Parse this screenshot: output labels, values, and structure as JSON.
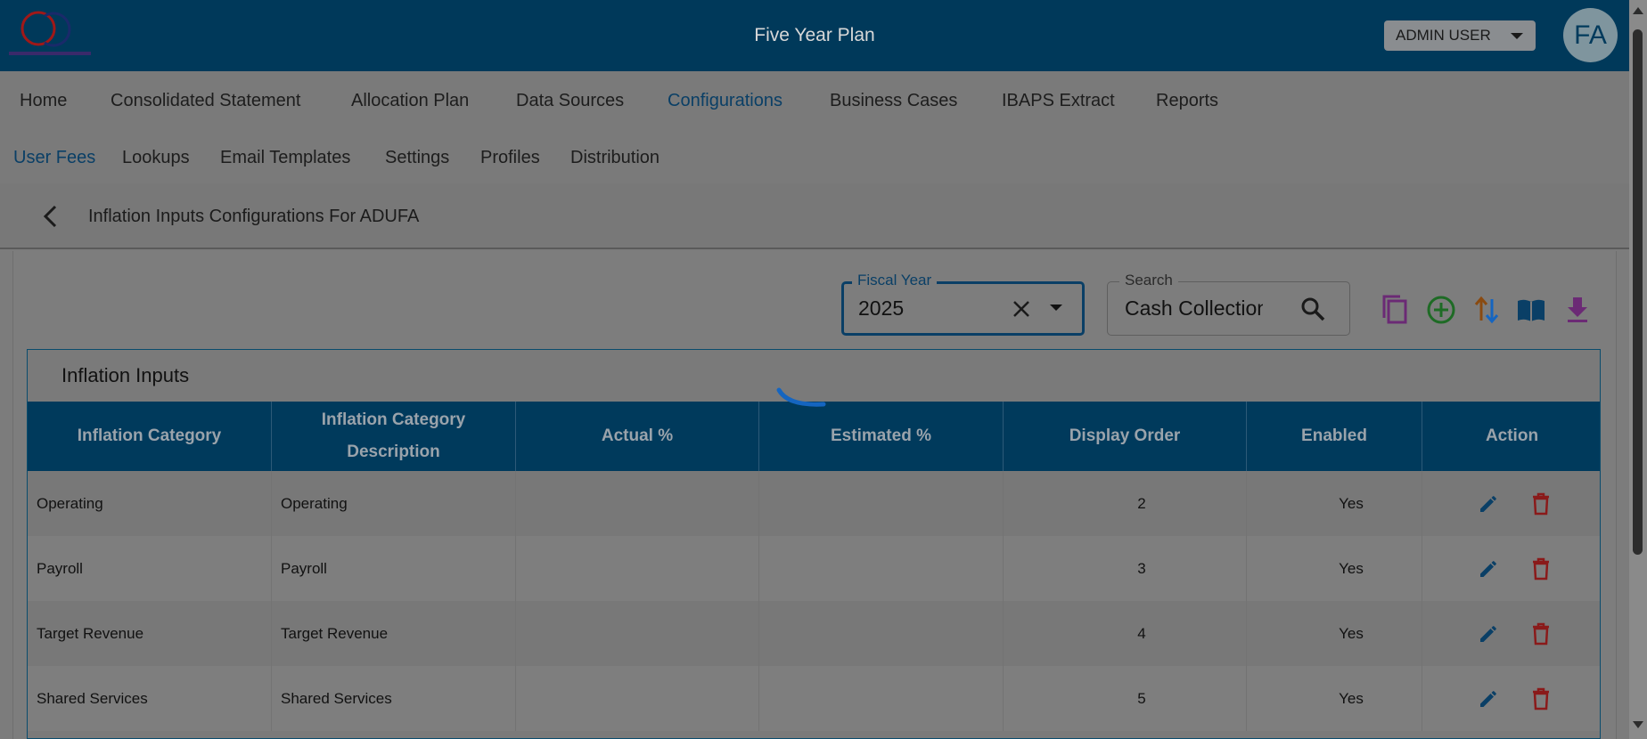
{
  "header": {
    "app_title": "Five Year Plan",
    "user_menu_label": "ADMIN USER",
    "avatar_initials": "FA",
    "logo_icon": "gc-logo-icon"
  },
  "nav": {
    "primary": [
      {
        "label": "Home",
        "active": false
      },
      {
        "label": "Consolidated Statement",
        "active": false
      },
      {
        "label": "Allocation Plan",
        "active": false
      },
      {
        "label": "Data Sources",
        "active": false
      },
      {
        "label": "Configurations",
        "active": true
      },
      {
        "label": "Business Cases",
        "active": false
      },
      {
        "label": "IBAPS Extract",
        "active": false
      },
      {
        "label": "Reports",
        "active": false
      }
    ],
    "secondary": [
      {
        "label": "User Fees",
        "active": true
      },
      {
        "label": "Lookups",
        "active": false
      },
      {
        "label": "Email Templates",
        "active": false
      },
      {
        "label": "Settings",
        "active": false
      },
      {
        "label": "Profiles",
        "active": false
      },
      {
        "label": "Distribution",
        "active": false
      }
    ]
  },
  "page": {
    "title": "Inflation Inputs Configurations For ADUFA"
  },
  "filters": {
    "fiscal_year_label": "Fiscal Year",
    "fiscal_year_value": "2025",
    "search_label": "Search",
    "search_value": "Cash Collection"
  },
  "toolbar": {
    "icons": [
      "copy-icon",
      "add-circle-icon",
      "sort-icon",
      "book-icon",
      "download-icon"
    ]
  },
  "table": {
    "title": "Inflation Inputs",
    "columns": [
      "Inflation Category",
      "Inflation Category Description",
      "Actual %",
      "Estimated %",
      "Display Order",
      "Enabled",
      "Action"
    ],
    "rows": [
      {
        "category": "Operating",
        "description": "Operating",
        "actual": "",
        "estimated": "",
        "order": "2",
        "enabled": "Yes"
      },
      {
        "category": "Payroll",
        "description": "Payroll",
        "actual": "",
        "estimated": "",
        "order": "3",
        "enabled": "Yes"
      },
      {
        "category": "Target Revenue",
        "description": "Target Revenue",
        "actual": "",
        "estimated": "",
        "order": "4",
        "enabled": "Yes"
      },
      {
        "category": "Shared Services",
        "description": "Shared Services",
        "actual": "",
        "estimated": "",
        "order": "5",
        "enabled": "Yes"
      }
    ]
  },
  "colors": {
    "header_bg": "#00395a",
    "accent": "#0a3f66",
    "copy_icon": "#6b2a75",
    "add_icon": "#1e6b25",
    "sort_icon_up": "#8a4a10",
    "book_icon": "#0a3f66",
    "download_icon": "#6b2a75",
    "edit_icon": "#0a3f66",
    "delete_icon": "#8a1a1a",
    "spinner": "#1565c0"
  }
}
